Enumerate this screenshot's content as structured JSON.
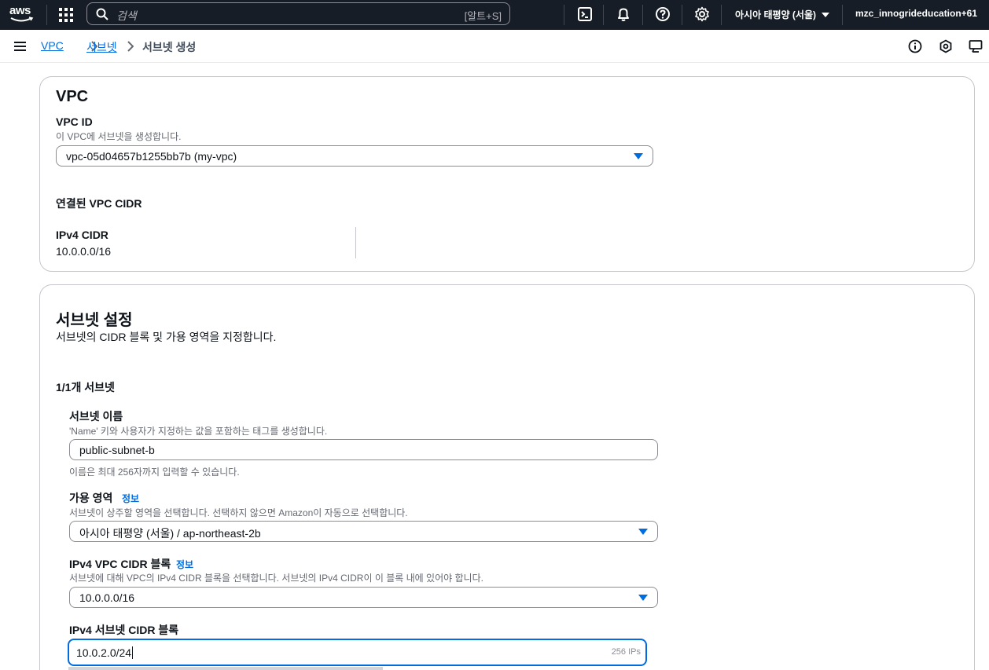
{
  "topnav": {
    "logo_text": "aws",
    "search_placeholder": "검색",
    "search_shortcut": "[알트+S]",
    "region": "아시아 태평양 (서울)",
    "account": "mzc_innogrideducation+61"
  },
  "breadcrumb": {
    "items": [
      "VPC",
      "서브넷",
      "서브넷 생성"
    ]
  },
  "vpc_panel": {
    "title": "VPC",
    "vpc_id_label": "VPC ID",
    "vpc_id_desc": "이 VPC에 서브넷을 생성합니다.",
    "vpc_id_value": "vpc-05d04657b1255bb7b (my-vpc)",
    "cidr_section_title": "연결된 VPC CIDR",
    "ipv4_cidr_label": "IPv4 CIDR",
    "ipv4_cidr_value": "10.0.0.0/16"
  },
  "subnet_panel": {
    "title": "서브넷 설정",
    "subtitle": "서브넷의 CIDR 블록 및 가용 영역을 지정합니다.",
    "count_label": "1/1개 서브넷",
    "name_label": "서브넷 이름",
    "name_desc": "'Name' 키와 사용자가 지정하는 값을 포함하는 태그를 생성합니다.",
    "name_value": "public-subnet-b",
    "name_hint": "이름은 최대 256자까지 입력할 수 있습니다.",
    "az_label": "가용 영역",
    "az_info": "정보",
    "az_desc": "서브넷이 상주할 영역을 선택합니다. 선택하지 않으면 Amazon이 자동으로 선택합니다.",
    "az_value": "아시아 태평양 (서울) / ap-northeast-2b",
    "vpc_cidr_label": "IPv4 VPC CIDR 블록",
    "vpc_cidr_info": "정보",
    "vpc_cidr_desc": "서브넷에 대해 VPC의 IPv4 CIDR 블록을 선택합니다. 서브넷의 IPv4 CIDR이 이 블록 내에 있어야 합니다.",
    "vpc_cidr_value": "10.0.0.0/16",
    "subnet_cidr_label": "IPv4 서브넷 CIDR 블록",
    "subnet_cidr_value": "10.0.2.0/24",
    "subnet_cidr_ips": "256 IPs"
  }
}
